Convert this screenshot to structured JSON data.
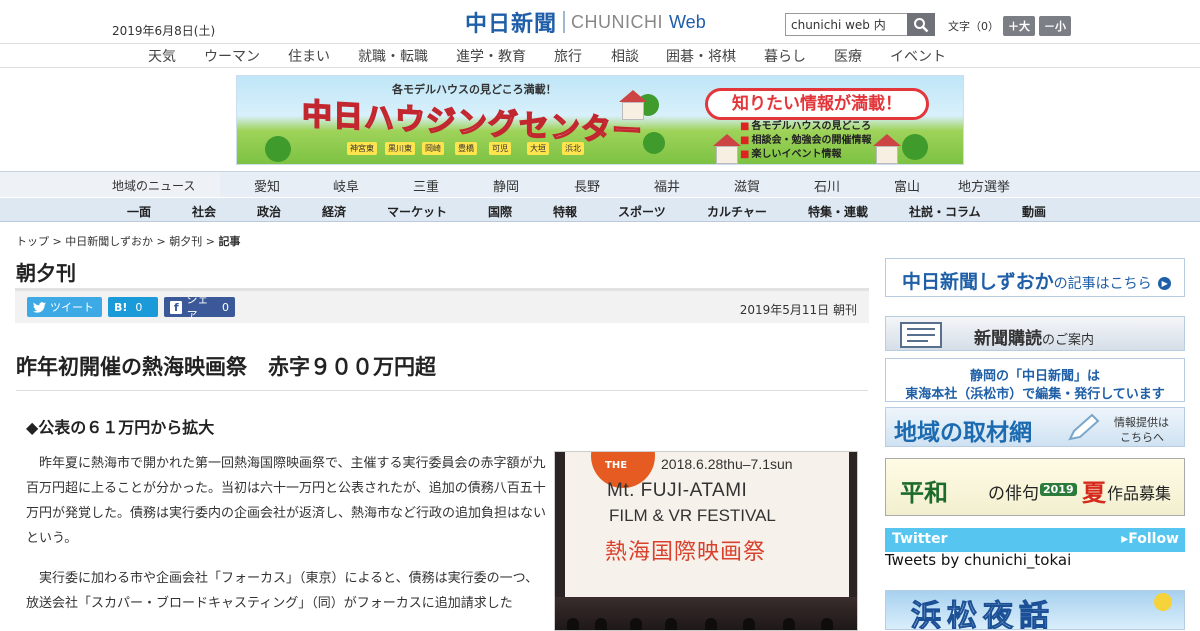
{
  "header": {
    "date": "2019年6月8日(土)",
    "logo_kanji": "中日新聞",
    "logo_latin": "CHUNICHI",
    "logo_web": "Web",
    "search_value": "chunichi web 内",
    "fontsize_label": "文字（0）",
    "font_larger": "＋大",
    "font_smaller": "－小"
  },
  "top_nav": [
    "天気",
    "ウーマン",
    "住まい",
    "就職・転職",
    "進学・教育",
    "旅行",
    "相談",
    "囲碁・将棋",
    "暮らし",
    "医療",
    "イベント"
  ],
  "banner": {
    "sub": "各モデルハウスの見どころ満載！",
    "main": "中日ハウジングセンター",
    "bubble": "知りたい情報が満載！",
    "lines": [
      "各モデルハウスの見どころ",
      "相談会・勉強会の開催情報",
      "楽しいイベント情報"
    ],
    "towns": [
      "神宮東",
      "黒川東",
      "岡崎",
      "豊橋",
      "可児",
      "大垣",
      "浜北"
    ]
  },
  "region_nav": {
    "label": "地域のニュース",
    "items": [
      "愛知",
      "岐阜",
      "三重",
      "静岡",
      "長野",
      "福井",
      "滋賀",
      "石川",
      "富山",
      "地方選挙"
    ]
  },
  "category_nav": [
    "一面",
    "社会",
    "政治",
    "経済",
    "マーケット",
    "国際",
    "特報",
    "スポーツ",
    "カルチャー",
    "特集・連載",
    "社説・コラム",
    "動画"
  ],
  "breadcrumb": {
    "top": "トップ",
    "sep": ">",
    "shizuoka": "中日新聞しずおか",
    "chouyuukan": "朝夕刊",
    "current": "記事"
  },
  "section_title": "朝夕刊",
  "share": {
    "tweet": "ツイート",
    "hatena": "B!",
    "hatena_count": "0",
    "fb": "シェア",
    "fb_count": "0"
  },
  "article": {
    "pub_date": "2019年5月11日 朝刊",
    "headline": "昨年初開催の熱海映画祭　赤字９００万円超",
    "subhead": "◆公表の６１万円から拡大",
    "paragraphs": [
      "昨年夏に熱海市で開かれた第一回熱海国際映画祭で、主催する実行委員会の赤字額が九百万円超に上ることが分かった。当初は六十一万円と公表されたが、追加の債務八百五十万円が発覚した。債務は実行委内の企画会社が返済し、熱海市など行政の追加負担はないという。",
      "実行委に加わる市や企画会社「フォーカス」（東京）によると、債務は実行委の一つ、放送会社「スカパー・ブロードキャスティング」（同）がフォーカスに追加請求した"
    ],
    "photo": {
      "the": "THE",
      "dates": "2018.6.28thu–7.1sun",
      "title1": "Mt. FUJI-ATAMI",
      "title2": "FILM & VR FESTIVAL",
      "jp": "熱海国際映画祭"
    }
  },
  "sidebar": {
    "shizuoka_link_main": "中日新聞しずおか",
    "shizuoka_link_sub": "の記事はこちら",
    "subscribe_main": "新聞購読",
    "subscribe_sub": "のご案内",
    "honsha_line1": "静岡の「中日新聞」は",
    "honsha_line2": "東海本社（浜松市）で編集・発行しています",
    "chizai_main": "地域の取材網",
    "chizai_sub1": "情報提供は",
    "chizai_sub2": "こちらへ",
    "haiku_main": "平和",
    "haiku_mid": "の俳句",
    "haiku_year": "2019",
    "haiku_season": "夏",
    "haiku_tail": "作品募集",
    "twitter_label": "Twitter",
    "twitter_follow": "▸Follow",
    "tweets_by": "Tweets by chunichi_tokai",
    "hamamatsu": "浜松夜話"
  },
  "colors": {
    "brand_blue": "#1f5ea8",
    "twitter": "#3daae6",
    "hatena": "#1a9ad8",
    "facebook": "#3b5999",
    "nav_bg": "#e7eef6"
  }
}
